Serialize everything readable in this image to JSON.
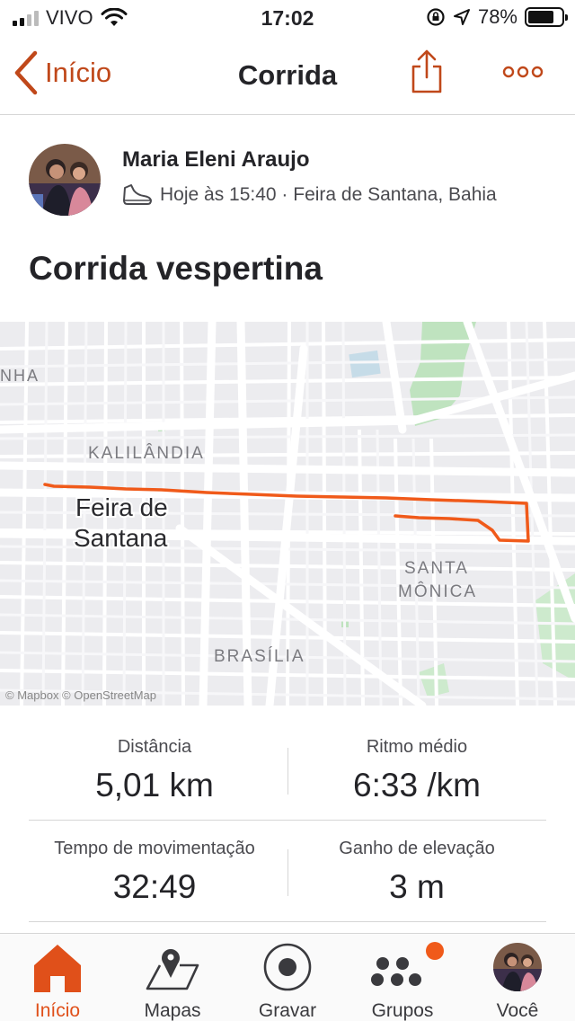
{
  "status_bar": {
    "carrier": "VIVO",
    "time": "17:02",
    "battery": "78%",
    "battery_level": 0.78
  },
  "nav": {
    "back_label": "Início",
    "title": "Corrida",
    "share_icon": "share-icon",
    "more_icon": "more-icon"
  },
  "athlete": {
    "name": "Maria Eleni Araujo",
    "meta": "Hoje às 15:40 · Feira de Santana, Bahia",
    "activity_icon": "shoe-icon"
  },
  "activity": {
    "title": "Corrida vespertina"
  },
  "map": {
    "labels": {
      "nha": "NHA",
      "kalilandia": "KALILÂNDIA",
      "city_line1": "Feira de",
      "city_line2": "Santana",
      "santa": "SANTA",
      "monica": "MÔNICA",
      "brasilia": "BRASÍLIA"
    },
    "attribution": "© Mapbox © OpenStreetMap",
    "route_color": "#f05a1a"
  },
  "stats": {
    "distance": {
      "label": "Distância",
      "value": "5,01 km"
    },
    "pace": {
      "label": "Ritmo médio",
      "value": "6:33 /km"
    },
    "moving_time": {
      "label": "Tempo de movimentação",
      "value": "32:49"
    },
    "elevation": {
      "label": "Ganho de elevação",
      "value": "3 m"
    }
  },
  "tabbar": {
    "items": [
      {
        "label": "Início",
        "icon": "home-icon",
        "active": true
      },
      {
        "label": "Mapas",
        "icon": "map-icon",
        "active": false
      },
      {
        "label": "Gravar",
        "icon": "record-icon",
        "active": false
      },
      {
        "label": "Grupos",
        "icon": "groups-icon",
        "active": false,
        "badge": true
      },
      {
        "label": "Você",
        "icon": "avatar",
        "active": false
      }
    ]
  },
  "colors": {
    "accent": "#e0501a",
    "accent_dark": "#c0481a",
    "text": "#242428",
    "divider": "#d6d6d6"
  }
}
